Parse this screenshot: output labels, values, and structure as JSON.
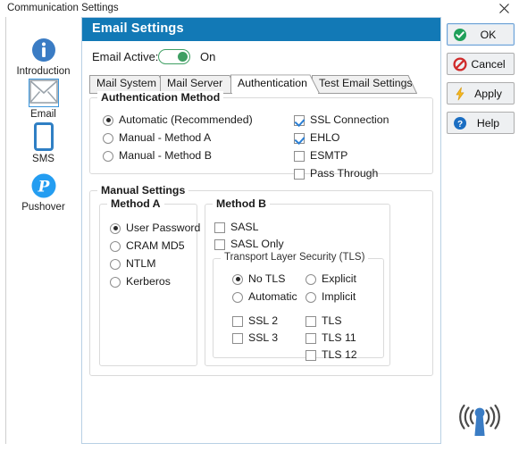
{
  "window": {
    "title": "Communication Settings",
    "close_icon": "close-icon"
  },
  "sidebar": {
    "items": [
      {
        "label": "Introduction",
        "icon": "info-icon",
        "selected": false
      },
      {
        "label": "Email",
        "icon": "envelope-icon",
        "selected": true
      },
      {
        "label": "SMS",
        "icon": "phone-icon",
        "selected": false
      },
      {
        "label": "Pushover",
        "icon": "pushover-icon",
        "selected": false
      }
    ]
  },
  "panel": {
    "header_title": "Email Settings",
    "active_label": "Email Active:",
    "active_state": "On",
    "toggle_on": true,
    "tabs": [
      {
        "label": "Mail System",
        "active": false
      },
      {
        "label": "Mail Server",
        "active": false
      },
      {
        "label": "Authentication",
        "active": true
      },
      {
        "label": "Test Email Settings",
        "active": false
      }
    ],
    "auth_group": {
      "title": "Authentication Method",
      "methods": [
        {
          "label": "Automatic (Recommended)",
          "checked": true
        },
        {
          "label": "Manual - Method A",
          "checked": false
        },
        {
          "label": "Manual - Method B",
          "checked": false
        }
      ],
      "options": [
        {
          "label": "SSL Connection",
          "checked": true
        },
        {
          "label": "EHLO",
          "checked": true
        },
        {
          "label": "ESMTP",
          "checked": false
        },
        {
          "label": "Pass Through",
          "checked": false
        }
      ]
    },
    "manual_group": {
      "title": "Manual Settings",
      "method_a": {
        "title": "Method A",
        "options": [
          {
            "label": "User Password",
            "checked": true
          },
          {
            "label": "CRAM MD5",
            "checked": false
          },
          {
            "label": "NTLM",
            "checked": false
          },
          {
            "label": "Kerberos",
            "checked": false
          }
        ]
      },
      "method_b": {
        "title": "Method B",
        "checks": [
          {
            "label": "SASL",
            "checked": false
          },
          {
            "label": "SASL Only",
            "checked": false
          }
        ],
        "tls": {
          "title": "Transport Layer Security (TLS)",
          "modes_left": [
            {
              "label": "No TLS",
              "checked": true
            },
            {
              "label": "Automatic",
              "checked": false
            }
          ],
          "modes_right": [
            {
              "label": "Explicit",
              "checked": false
            },
            {
              "label": "Implicit",
              "checked": false
            }
          ],
          "protocols_left": [
            {
              "label": "SSL 2",
              "checked": false
            },
            {
              "label": "SSL 3",
              "checked": false
            }
          ],
          "protocols_right": [
            {
              "label": "TLS",
              "checked": false
            },
            {
              "label": "TLS 11",
              "checked": false
            },
            {
              "label": "TLS 12",
              "checked": false
            }
          ]
        }
      }
    }
  },
  "buttons": [
    {
      "label": "OK",
      "icon": "check-circle-icon",
      "default": true
    },
    {
      "label": "Cancel",
      "icon": "forbidden-icon",
      "default": false
    },
    {
      "label": "Apply",
      "icon": "lightning-icon",
      "default": false
    },
    {
      "label": "Help",
      "icon": "question-circle-icon",
      "default": false
    }
  ],
  "decoration": {
    "antenna_icon": "wifi-antenna-icon"
  },
  "colors": {
    "header_blue": "#1279b6",
    "accent_blue": "#2a7fd4",
    "toggle_green": "#3f9f63",
    "panel_border": "#b8d0e4",
    "icon_blue": "#3a7cc4"
  }
}
